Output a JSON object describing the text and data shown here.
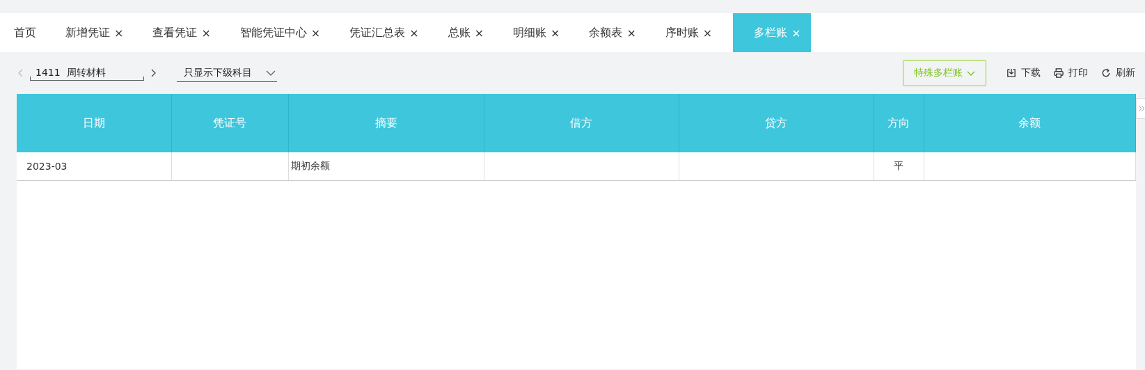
{
  "tabs": [
    {
      "label": "首页",
      "closable": false,
      "selected": false
    },
    {
      "label": "新增凭证",
      "closable": true,
      "selected": false
    },
    {
      "label": "查看凭证",
      "closable": true,
      "selected": false
    },
    {
      "label": "智能凭证中心",
      "closable": true,
      "selected": false
    },
    {
      "label": "凭证汇总表",
      "closable": true,
      "selected": false
    },
    {
      "label": "总账",
      "closable": true,
      "selected": false
    },
    {
      "label": "明细账",
      "closable": true,
      "selected": false
    },
    {
      "label": "余额表",
      "closable": true,
      "selected": false
    },
    {
      "label": "序时账",
      "closable": true,
      "selected": false
    },
    {
      "label": "多栏账",
      "closable": true,
      "selected": true
    }
  ],
  "close_glyph": "×",
  "toolbar": {
    "account": {
      "code": "1411",
      "name": "周转材料"
    },
    "filter": {
      "value": "只显示下级科目"
    },
    "special_button": "特殊多栏账",
    "actions": [
      {
        "kind": "download",
        "label": "下载"
      },
      {
        "kind": "print",
        "label": "打印"
      },
      {
        "kind": "refresh",
        "label": "刷新"
      }
    ]
  },
  "table": {
    "columns": [
      "日期",
      "凭证号",
      "摘要",
      "借方",
      "贷方",
      "方向",
      "余额"
    ],
    "rows": [
      [
        "2023-03",
        "",
        "期初余额",
        "",
        "",
        "平",
        ""
      ]
    ]
  }
}
